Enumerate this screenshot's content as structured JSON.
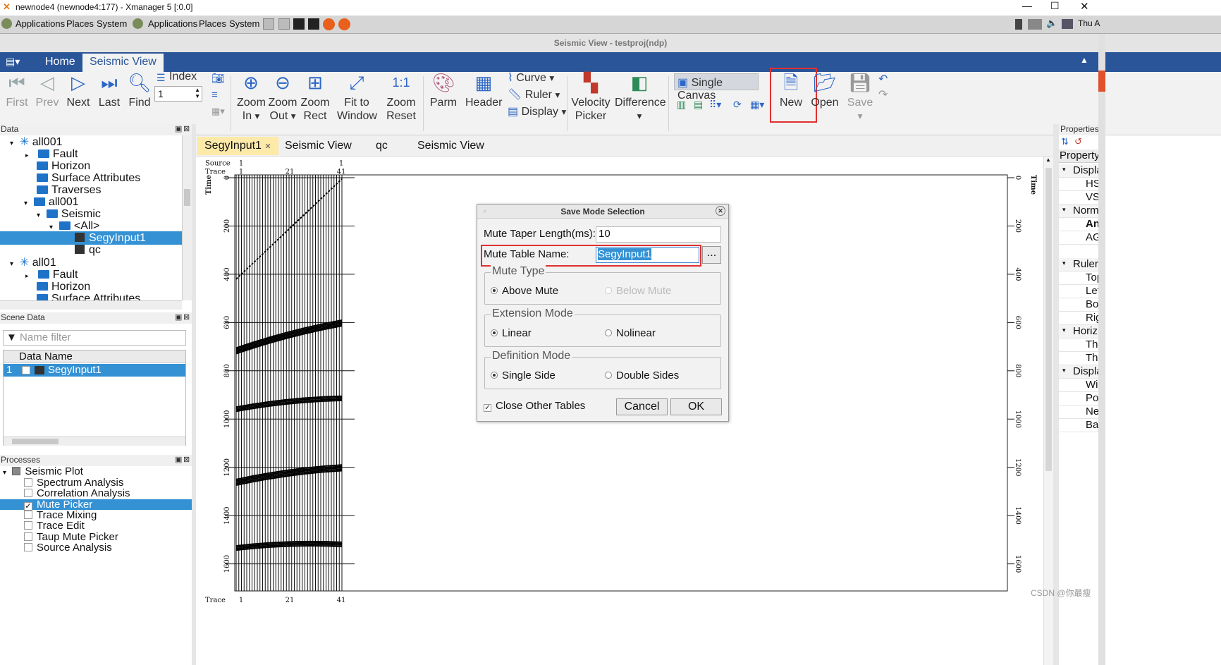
{
  "window": {
    "title": "newnode4 (newnode4:177) - Xmanager 5 [:0.0]"
  },
  "gnome_panel": {
    "items": [
      "Applications",
      "Places",
      "System",
      "Applications",
      "Places",
      "System"
    ],
    "clock": "Thu A"
  },
  "app": {
    "title": "Seismic View - testproj(ndp)"
  },
  "ribbon_tabs": [
    "Home",
    "Seismic View"
  ],
  "toolbar": {
    "first": "First",
    "prev": "Prev",
    "next": "Next",
    "last": "Last",
    "find": "Find",
    "index_label": "Index",
    "index_value": "1",
    "zoom_in": [
      "Zoom",
      "In"
    ],
    "zoom_out": [
      "Zoom",
      "Out"
    ],
    "zoom_rect": [
      "Zoom",
      "Rect"
    ],
    "fit_window": [
      "Fit to",
      "Window"
    ],
    "zoom_reset": [
      "Zoom",
      "Reset"
    ],
    "parm": "Parm",
    "header": "Header",
    "curve": "Curve",
    "ruler": "Ruler",
    "display": "Display",
    "velocity_picker": [
      "Velocity",
      "Picker"
    ],
    "difference": "Difference",
    "single_canvas": "Single Canvas",
    "new": "New",
    "open": "Open",
    "save": "Save"
  },
  "data_panel": {
    "title": "Data",
    "tree": [
      {
        "label": "all001",
        "level": 0
      },
      {
        "label": "Fault",
        "level": 1
      },
      {
        "label": "Horizon",
        "level": 1
      },
      {
        "label": "Surface Attributes",
        "level": 1
      },
      {
        "label": "Traverses",
        "level": 1
      },
      {
        "label": "all001",
        "level": 1
      },
      {
        "label": "Seismic",
        "level": 2
      },
      {
        "label": "<All>",
        "level": 3
      },
      {
        "label": "SegyInput1",
        "level": 4
      },
      {
        "label": "qc",
        "level": 4
      },
      {
        "label": "all01",
        "level": 0
      },
      {
        "label": "Fault",
        "level": 1
      },
      {
        "label": "Horizon",
        "level": 1
      },
      {
        "label": "Surface Attributes",
        "level": 1
      }
    ]
  },
  "scene_panel": {
    "title": "Scene Data",
    "filter_placeholder": "Name filter",
    "column": "Data Name",
    "row_index": "1",
    "row_name": "SegyInput1"
  },
  "processes_panel": {
    "title": "Processes",
    "root": "Seismic Plot",
    "items": [
      "Spectrum Analysis",
      "Correlation Analysis",
      "Mute Picker",
      "Trace Mixing",
      "Trace Edit",
      "Taup Mute Picker",
      "Source Analysis"
    ]
  },
  "doc_tabs": [
    "SegyInput1",
    "Seismic View",
    "qc",
    "Seismic View"
  ],
  "plot": {
    "source_label": "Source",
    "trace_label": "Trace",
    "source_ticks": [
      "1",
      "1"
    ],
    "trace_ticks": [
      "1",
      "21",
      "41"
    ],
    "time_label": "Time",
    "time_ticks": [
      "0",
      "200",
      "400",
      "600",
      "800",
      "1000",
      "1200",
      "1400",
      "1600"
    ]
  },
  "dialog": {
    "title": "Save Mode Selection",
    "taper_label": "Mute Taper Length(ms):",
    "taper_value": "10",
    "table_label": "Mute Table Name:",
    "table_value": "SegyInput1",
    "browse": "...",
    "mute_type": "Mute Type",
    "above": "Above Mute",
    "below": "Below Mute",
    "extension_mode": "Extension Mode",
    "linear": "Linear",
    "nolinear": "Nolinear",
    "definition_mode": "Definition Mode",
    "single": "Single Side",
    "double": "Double Sides",
    "close_other": "Close Other Tables",
    "cancel": "Cancel",
    "ok": "OK"
  },
  "properties": {
    "title": "Properties",
    "header": "Property",
    "rows": [
      "Displa",
      "HS",
      "VS",
      "Norm",
      "An",
      "AG",
      "Ruler",
      "Top",
      "Lef",
      "Bo",
      "Rig",
      "Horiz",
      "Th",
      "Th",
      "Displa",
      "Wi",
      "Po",
      "Ne",
      "Ba"
    ]
  },
  "watermark": "CSDN @你最瘦"
}
